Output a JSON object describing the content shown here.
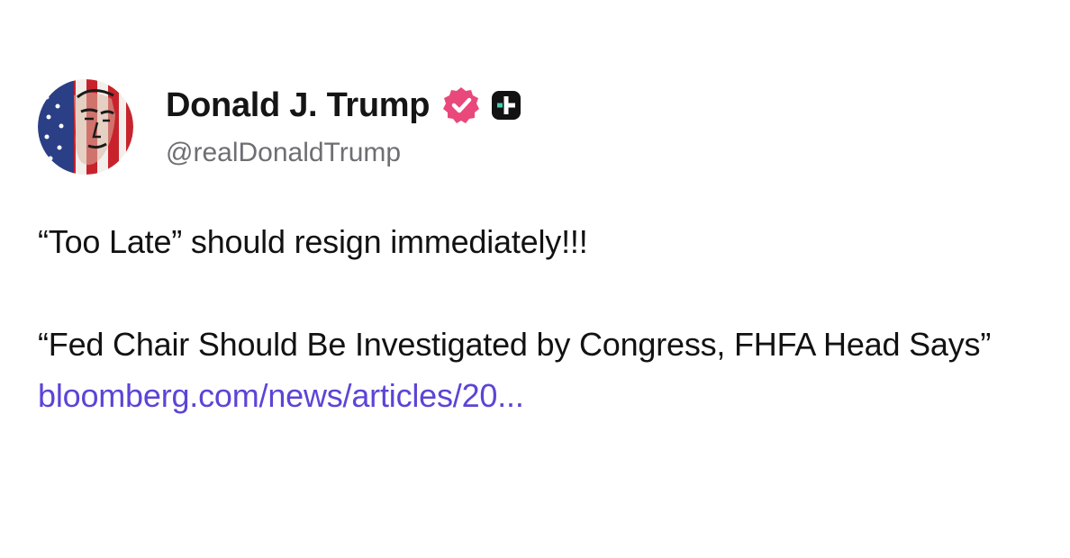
{
  "post": {
    "author": {
      "display_name": "Donald J. Trump",
      "handle": "@realDonaldTrump",
      "avatar_icon": "flag-portrait-avatar",
      "verified_icon": "verified-badge-icon",
      "verified_color": "#e9487b",
      "plus_icon": "plus-badge-icon"
    },
    "paragraph_1": "“Too Late” should resign immediately!!!",
    "paragraph_2_text": "“Fed Chair Should Be Investigated by Congress, FHFA Head Says” ",
    "link_text": "bloomberg.com/news/articles/20...",
    "link_color": "#5b45d6"
  }
}
